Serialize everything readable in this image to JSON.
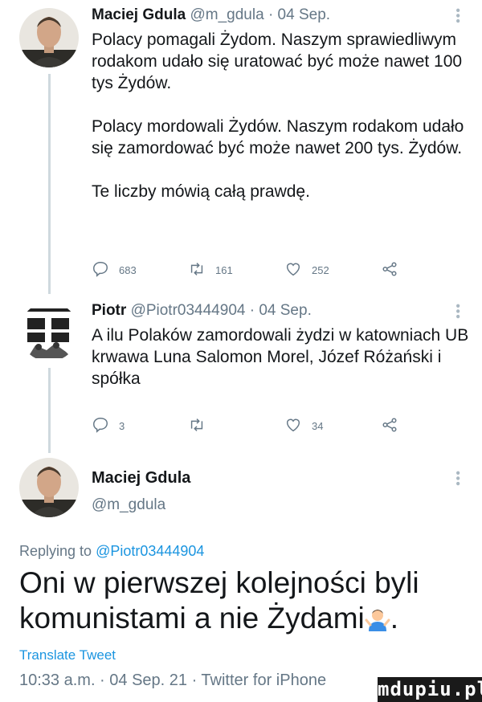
{
  "tweet1": {
    "name": "Maciej Gdula",
    "handle": "@m_gdula",
    "separator": "·",
    "date": "04 Sep.",
    "paragraphs": [
      "Polacy pomagali Żydom. Naszym sprawiedliwym rodakom udało się uratować być może nawet 100 tys Żydów.",
      "Polacy mordowali Żydów. Naszym rodakom udało się zamordować być może nawet 200 tys. Żydów.",
      "Te liczby mówią całą prawdę."
    ],
    "replies": "683",
    "retweets": "161",
    "likes": "252"
  },
  "tweet2": {
    "name": "Piotr",
    "handle": "@Piotr03444904",
    "separator": "·",
    "date": "04 Sep.",
    "text": "A ilu Polaków zamordowali żydzi w katowniach UB krwawa Luna Salomon Morel, Józef Różański i spółka",
    "replies": "3",
    "retweets": "",
    "likes": "34"
  },
  "main": {
    "name": "Maciej Gdula",
    "handle": "@m_gdula",
    "replying_prefix": "Replying to",
    "replying_to": "@Piotr03444904",
    "text": "Oni w pierwszej kolejności byli komunistami a nie Żydami",
    "text_end": ".",
    "translate": "Translate Tweet",
    "timestamp": "10:33 a.m. · 04 Sep. 21 · Twitter for iPhone"
  },
  "watermark": "mdupiu.pl",
  "icons": {
    "reply": "reply-icon",
    "retweet": "retweet-icon",
    "like": "heart-icon",
    "share": "share-icon",
    "more": "more-icon",
    "emoji": "man-shrugging-emoji"
  },
  "colors": {
    "text": "#14171a",
    "secondary": "#657786",
    "link": "#1b95e0",
    "thread": "#cfd9de"
  }
}
